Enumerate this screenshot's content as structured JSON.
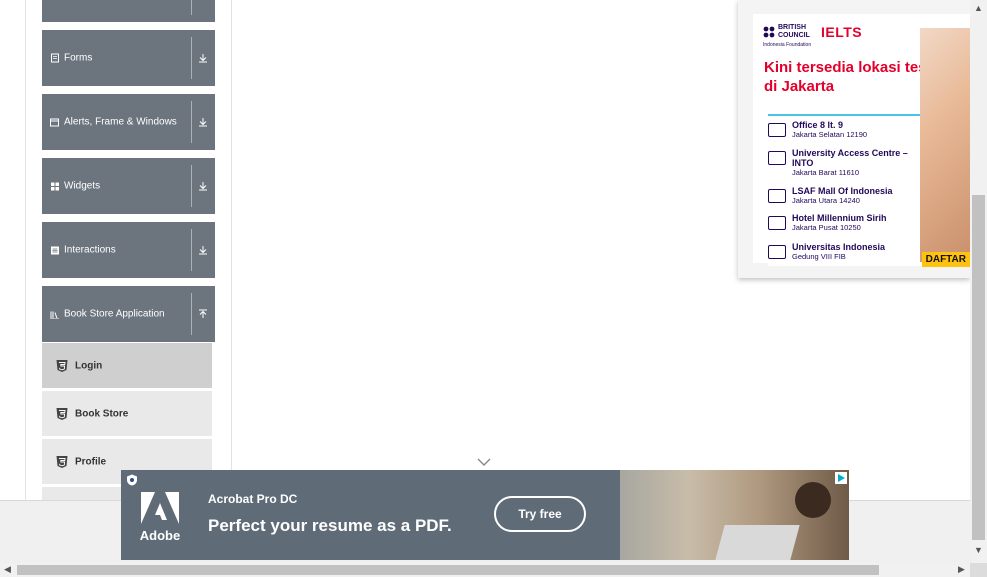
{
  "sidebar": {
    "groups": [
      {
        "label": "",
        "icon": "collapsed-group-icon"
      },
      {
        "label": "Forms",
        "icon": "file-icon"
      },
      {
        "label": "Alerts, Frame & Windows",
        "icon": "window-icon"
      },
      {
        "label": "Widgets",
        "icon": "grid-icon"
      },
      {
        "label": "Interactions",
        "icon": "list-icon"
      },
      {
        "label": "Book Store Application",
        "icon": "book-icon"
      }
    ],
    "book_store_items": [
      {
        "label": "Login",
        "icon": "html5-icon"
      },
      {
        "label": "Book Store",
        "icon": "html5-icon"
      },
      {
        "label": "Profile",
        "icon": "html5-icon"
      }
    ]
  },
  "ielts_ad": {
    "brand_text": "BRITISH COUNCIL",
    "ielts_logo": "IELTS",
    "foundation": "Indonesia Foundation",
    "headline": "Kini tersedia lokasi test di Jakarta",
    "locations": [
      {
        "name": "Office 8 lt. 9",
        "detail": "Jakarta Selatan 12190"
      },
      {
        "name": "University Access Centre – INTO",
        "detail": "Jakarta Barat 11610"
      },
      {
        "name": "LSAF Mall Of Indonesia",
        "detail": "Jakarta Utara 14240"
      },
      {
        "name": "Hotel Millennium Sirih",
        "detail": "Jakarta Pusat 10250"
      },
      {
        "name": "Universitas Indonesia",
        "detail": "Gedung VIII FIB"
      }
    ],
    "cta": "DAFTAR",
    "accent_color": "#e4002b",
    "box_color": "#4bc4ea"
  },
  "adobe_ad": {
    "brand": "Adobe",
    "product": "Acrobat Pro DC",
    "tagline": "Perfect your resume as a PDF.",
    "cta": "Try free",
    "background_color": "#5f6b77"
  }
}
